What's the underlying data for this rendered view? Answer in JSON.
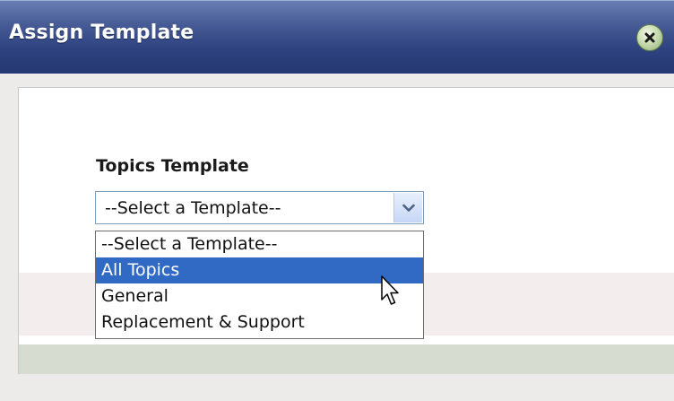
{
  "dialog": {
    "title": "Assign Template",
    "close_icon": "close-icon"
  },
  "form": {
    "label": "Topics Template",
    "select": {
      "value": "--Select a Template--",
      "arrow_icon": "chevron-down-icon"
    },
    "options": [
      {
        "label": "--Select a Template--",
        "highlighted": false
      },
      {
        "label": "All Topics",
        "highlighted": true
      },
      {
        "label": "General",
        "highlighted": false
      },
      {
        "label": "Replacement & Support",
        "highlighted": false
      }
    ]
  },
  "colors": {
    "title_bar": "#2e4380",
    "highlight": "#316ac5",
    "select_border": "#7f9db9"
  },
  "cursor_icon": "mouse-pointer-icon"
}
